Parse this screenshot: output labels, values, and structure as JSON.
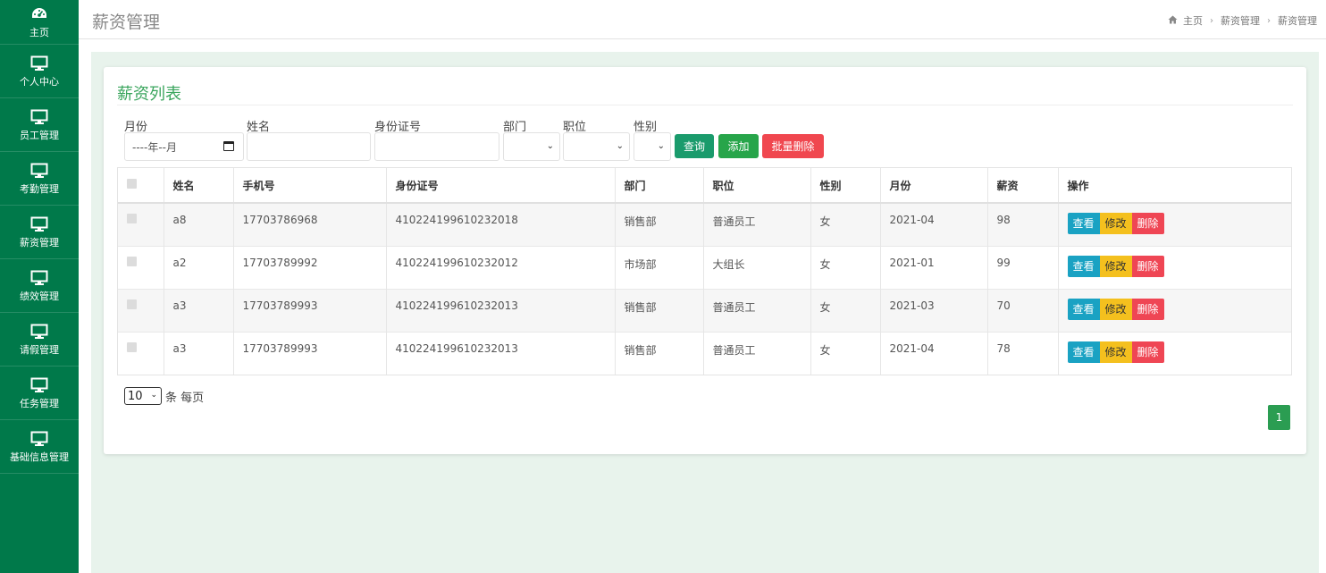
{
  "sidebar": {
    "items": [
      {
        "label": "主页",
        "icon": "dashboard-icon"
      },
      {
        "label": "个人中心",
        "icon": "monitor-icon"
      },
      {
        "label": "员工管理",
        "icon": "monitor-icon"
      },
      {
        "label": "考勤管理",
        "icon": "monitor-icon"
      },
      {
        "label": "薪资管理",
        "icon": "monitor-icon"
      },
      {
        "label": "绩效管理",
        "icon": "monitor-icon"
      },
      {
        "label": "请假管理",
        "icon": "monitor-icon"
      },
      {
        "label": "任务管理",
        "icon": "monitor-icon"
      },
      {
        "label": "基础信息管理",
        "icon": "monitor-icon"
      }
    ]
  },
  "header": {
    "title": "薪资管理",
    "breadcrumb": [
      "主页",
      "薪资管理",
      "薪资管理"
    ]
  },
  "card": {
    "title": "薪资列表"
  },
  "filters": {
    "month_label": "月份",
    "month_placeholder": "----年--月",
    "name_label": "姓名",
    "id_label": "身份证号",
    "dept_label": "部门",
    "position_label": "职位",
    "gender_label": "性别"
  },
  "buttons": {
    "query": "查询",
    "add": "添加",
    "batch_delete": "批量删除"
  },
  "table": {
    "columns": [
      "姓名",
      "手机号",
      "身份证号",
      "部门",
      "职位",
      "性别",
      "月份",
      "薪资",
      "操作"
    ],
    "rows": [
      {
        "name": "a8",
        "phone": "17703786968",
        "id": "410224199610232018",
        "dept": "销售部",
        "position": "普通员工",
        "gender": "女",
        "month": "2021-04",
        "salary": "98"
      },
      {
        "name": "a2",
        "phone": "17703789992",
        "id": "410224199610232012",
        "dept": "市场部",
        "position": "大组长",
        "gender": "女",
        "month": "2021-01",
        "salary": "99"
      },
      {
        "name": "a3",
        "phone": "17703789993",
        "id": "410224199610232013",
        "dept": "销售部",
        "position": "普通员工",
        "gender": "女",
        "month": "2021-03",
        "salary": "70"
      },
      {
        "name": "a3",
        "phone": "17703789993",
        "id": "410224199610232013",
        "dept": "销售部",
        "position": "普通员工",
        "gender": "女",
        "month": "2021-04",
        "salary": "78"
      }
    ],
    "actions": {
      "view": "查看",
      "edit": "修改",
      "delete": "删除"
    }
  },
  "pagination": {
    "page_size": "10",
    "page_size_suffix": "条 每页",
    "current_page": "1"
  },
  "colors": {
    "sidebar": "#00794a",
    "title_green": "#3aa55d",
    "query": "#1a9b6c",
    "add": "#27a54a",
    "danger": "#f0474f",
    "view": "#1aa2c3",
    "edit": "#f4c01e"
  }
}
